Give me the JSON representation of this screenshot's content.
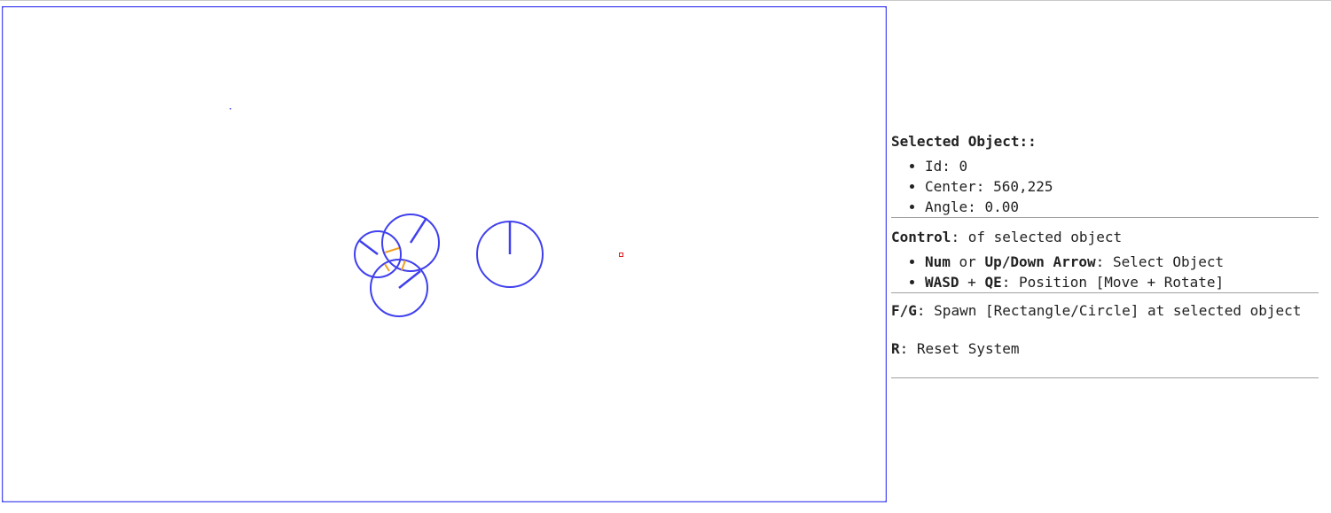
{
  "viewport": {
    "border_color": "#4a4af0",
    "shape_color": "#4040ee",
    "collision_color": "#f0a020",
    "marker_color": "#e02020"
  },
  "panel": {
    "selected_title": "Selected Object::",
    "selected_items": [
      {
        "label": "Id:",
        "value": "0"
      },
      {
        "label": "Center:",
        "value": "560,225"
      },
      {
        "label": "Angle:",
        "value": "0.00"
      }
    ],
    "control_key": "Control",
    "control_text": ": of selected object",
    "controls": [
      {
        "key1": "Num",
        "mid": " or ",
        "key2": "Up/Down Arrow",
        "desc": ": Select Object"
      },
      {
        "key1": "WASD",
        "mid": " + ",
        "key2": "QE",
        "desc": ": Position [Move + Rotate]"
      }
    ],
    "spawn_key": "F/G",
    "spawn_text": ": Spawn [Rectangle/Circle] at selected object",
    "reset_key": "R",
    "reset_text": ": Reset System"
  }
}
